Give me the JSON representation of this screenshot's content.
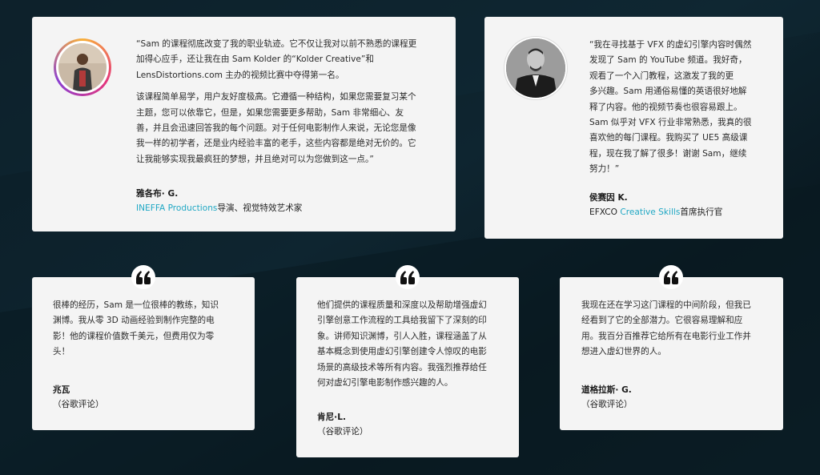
{
  "testimonials_top": [
    {
      "quote_p1_a": "“Sam 的课程彻底改变了我的职业轨迹。它不仅让我对以前不熟悉的课程更",
      "quote_p1_b": "加得心应手，还让我在由 Sam Kolder 的“Kolder Creative”和",
      "quote_p1_c": "LensDistortions.com 主办的视频比赛中夺得第一名。",
      "quote_p2_lines": [
        "该课程简单易学，用户友好度极高。它遵循一种结构，如果您需要复习某个",
        "主题，您可以依靠它，但是，如果您需要更多帮助，Sam 非常细心、友",
        "善，并且会迅速回答我的每个问题。对于任何电影制作人来说，无论您是像",
        "我一样的初学者，还是业内经验丰富的老手，这些内容都是绝对无价的。它",
        "让我能够实现我最疯狂的梦想，并且绝对可以为您做到这一点。”"
      ],
      "author": "雅各布· G.",
      "role_link": "INEFFA Productions",
      "role_rest": "导演、视觉特效艺术家"
    },
    {
      "quote_lines": [
        "“我在寻找基于 VFX 的虚幻引擎内容时偶然",
        "发现了 Sam 的 YouTube 频道。我好奇，",
        "观看了一个入门教程，这激发了我的更",
        "多兴趣。Sam 用通俗易懂的英语很好地解",
        "释了内容。他的视频节奏也很容易跟上。",
        "Sam 似乎对 VFX 行业非常熟悉，我真的很",
        "喜欢他的每门课程。我购买了 UE5 高级课",
        "程，现在我了解了很多！谢谢 Sam，继续",
        "努力！”"
      ],
      "author": "侯赛因 K.",
      "role_prefix": "EFXCO ",
      "role_link": "Creative Skills",
      "role_rest": "首席执行官"
    }
  ],
  "testimonials_bottom": [
    {
      "quote_lines": [
        "很棒的经历，Sam 是一位很棒的教练，知识",
        "渊博。我从零 3D 动画经验到制作完整的电",
        "影！他的课程价值数千美元，但费用仅为零",
        "头！"
      ],
      "author": "兆瓦",
      "source": "（谷歌评论）"
    },
    {
      "quote_lines": [
        "他们提供的课程质量和深度以及帮助增强虚幻",
        "引擎创意工作流程的工具给我留下了深刻的印",
        "象。讲师知识渊博，引人入胜，课程涵盖了从",
        "基本概念到使用虚幻引擎创建令人惊叹的电影",
        "场景的高级技术等所有内容。我强烈推荐给任",
        "何对虚幻引擎电影制作感兴趣的人。"
      ],
      "author": "肯尼·L.",
      "source": "（谷歌评论）"
    },
    {
      "quote_lines": [
        "我现在还在学习这门课程的中间阶段，但我已",
        "经看到了它的全部潜力。它很容易理解和应",
        "用。我百分百推荐它给所有在电影行业工作并",
        "想进入虚幻世界的人。"
      ],
      "author": "道格拉斯· G.",
      "source": "（谷歌评论）"
    }
  ],
  "icons": {
    "quote_mark": "quote-icon",
    "avatar1": "avatar-photo",
    "avatar2": "avatar-photo"
  },
  "colors": {
    "link": "#21a8c4",
    "card_bg": "#f4f4f4",
    "page_bg": "#0e2530"
  }
}
